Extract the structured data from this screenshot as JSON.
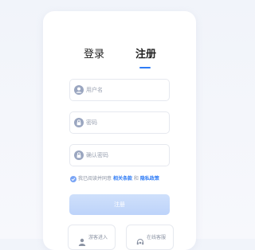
{
  "tabs": {
    "login": "登录",
    "register": "注册"
  },
  "fields": {
    "username_placeholder": "用户名",
    "password_placeholder": "密码",
    "confirm_placeholder": "确认密码"
  },
  "agreement": {
    "prefix": "我已阅读并同意",
    "terms": "相关条款",
    "and": "和",
    "privacy": "隐私政策"
  },
  "submit_label": "注册",
  "alt": {
    "guest": "游客进入",
    "service": "在线客服"
  },
  "colors": {
    "accent": "#2f7cf6",
    "icon_gray": "#9aa6c0"
  }
}
